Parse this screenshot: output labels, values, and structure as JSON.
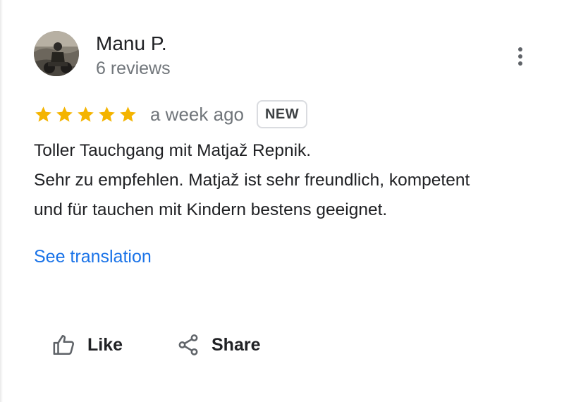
{
  "reviewer": {
    "name": "Manu P.",
    "review_count": "6 reviews",
    "avatar_icon": "profile-photo"
  },
  "menu": {
    "icon": "more-vert-icon"
  },
  "rating": {
    "stars": 5,
    "max_stars": 5,
    "star_color": "#f4b400",
    "time_ago": "a week ago",
    "badge": "NEW"
  },
  "review": {
    "lines": [
      "Toller Tauchgang mit Matjaž Repnik.",
      "Sehr zu empfehlen. Matjaž ist sehr freundlich, kompetent",
      "und für tauchen mit Kindern bestens geeignet."
    ]
  },
  "translation_link": "See translation",
  "actions": {
    "like_label": "Like",
    "like_icon": "thumb-up-icon",
    "share_label": "Share",
    "share_icon": "share-icon"
  },
  "colors": {
    "link": "#1a73e8",
    "text_primary": "#202124",
    "text_secondary": "#70757a"
  }
}
